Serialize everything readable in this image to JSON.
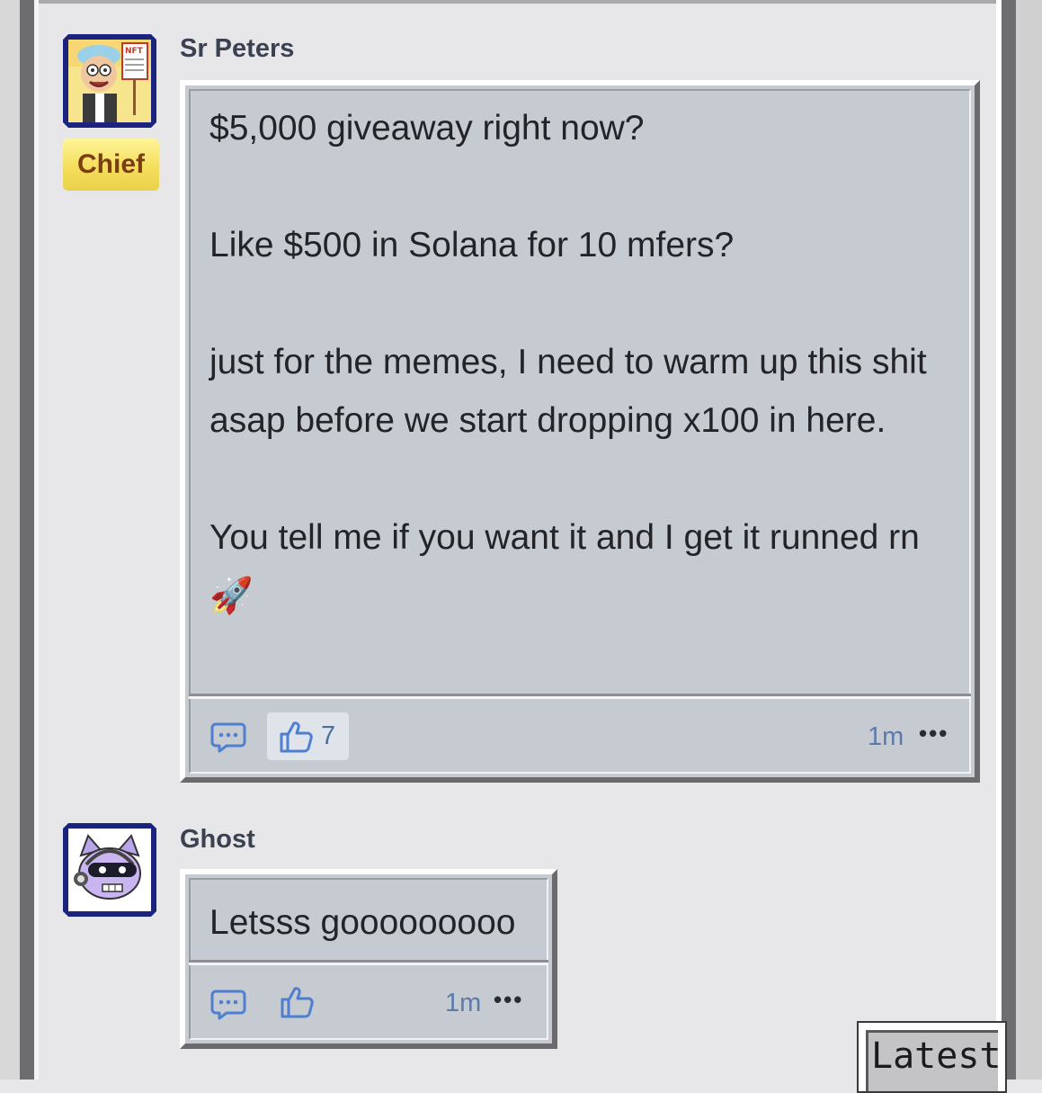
{
  "messages": [
    {
      "author": "Sr Peters",
      "role_badge": "Chief",
      "avatar_icon": "nft-sign-character-avatar",
      "paragraphs": [
        "$5,000 giveaway right now?",
        "Like $500 in Solana for 10 mfers?",
        "just for the memes, I need to warm up this shit asap before we start dropping x100 in here.",
        "You tell me if you want it and I get it runned rn 🚀"
      ],
      "like_count": "7",
      "time": "1m",
      "more": "•••"
    },
    {
      "author": "Ghost",
      "avatar_icon": "ghost-cat-avatar",
      "paragraphs": [
        "Letsss gooooooooo"
      ],
      "time": "1m",
      "more": "•••"
    }
  ],
  "latest_button": "Latest",
  "colors": {
    "bubble": "#c6cad1",
    "page": "#e7e7e9",
    "accent_icon": "#4f7fd1",
    "badge": "#f4de5c"
  }
}
